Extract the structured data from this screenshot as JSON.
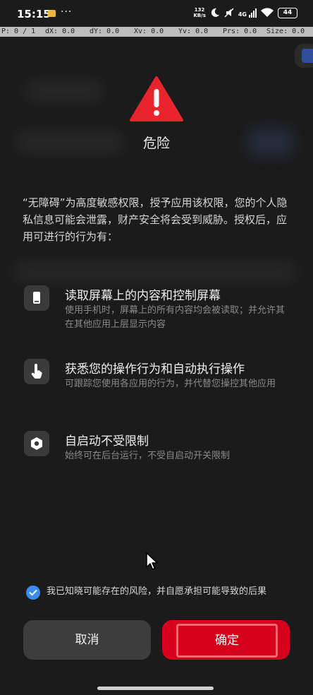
{
  "status_bar": {
    "time": "15:15",
    "more": "···",
    "net_speed_value": "132",
    "net_speed_unit": "KB/s",
    "signal_label": "4G",
    "battery": "44"
  },
  "debug_bar": {
    "p": "P: 0 / 1",
    "dx": "dX: 0.0",
    "dy": "dY: 0.0",
    "xv": "Xv: 0.0",
    "yv": "Yv: 0.0",
    "prs": "Prs: 0.0",
    "size": "Size: 0.0"
  },
  "dialog": {
    "title": "危险",
    "description": "“无障碍”为高度敏感权限，授予应用该权限，您的个人隐私信息可能会泄露，财产安全将会受到威胁。授权后，应用可进行的行为有：",
    "permissions": [
      {
        "icon": "phone-screen-icon",
        "title": "读取屏幕上的内容和控制屏幕",
        "subtitle": "使用手机时，屏幕上的所有内容均会被读取；并允许其在其他应用上层显示内容"
      },
      {
        "icon": "touch-hand-icon",
        "title": "获悉您的操作行为和自动执行操作",
        "subtitle": "可跟踪您使用各应用的行为，并代替您操控其他应用"
      },
      {
        "icon": "hexagon-gear-icon",
        "title": "自启动不受限制",
        "subtitle": "始终可在后台运行，不受自启动开关限制"
      }
    ],
    "consent_text": "我已知晓可能存在的风险，并自愿承担可能导致的后果",
    "consent_checked": true,
    "cancel_label": "取消",
    "confirm_label": "确定",
    "colors": {
      "warning": "#e8242c",
      "confirm": "#d7001c",
      "check": "#3a8bf0"
    }
  }
}
